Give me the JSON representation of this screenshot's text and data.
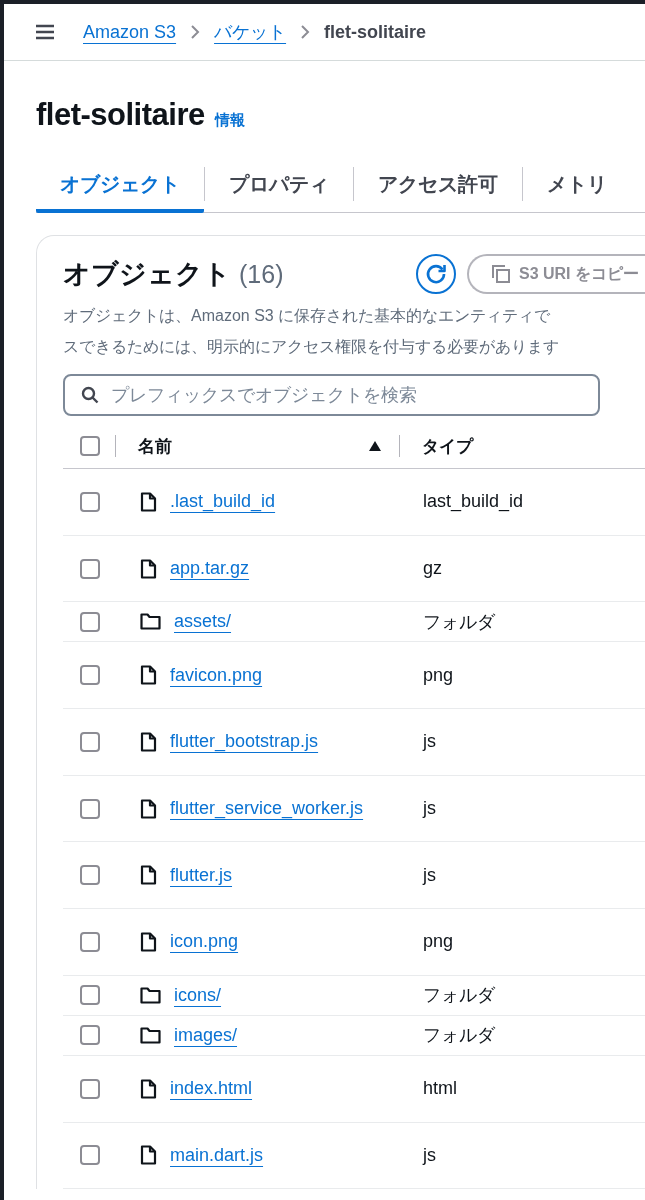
{
  "breadcrumb": [
    {
      "label": "Amazon S3",
      "current": false
    },
    {
      "label": "バケット",
      "current": false
    },
    {
      "label": "flet-solitaire",
      "current": true
    }
  ],
  "page": {
    "title": "flet-solitaire",
    "info": "情報"
  },
  "tabs": [
    {
      "label": "オブジェクト",
      "selected": true
    },
    {
      "label": "プロパティ",
      "selected": false
    },
    {
      "label": "アクセス許可",
      "selected": false
    },
    {
      "label": "メトリ",
      "selected": false
    }
  ],
  "objects_panel": {
    "title": "オブジェクト",
    "count": "(16)",
    "copy_button": "S3 URI をコピー",
    "description": [
      "オブジェクトは、Amazon S3 に保存された基本的なエンティティで",
      "スできるためには、明示的にアクセス権限を付与する必要があります"
    ],
    "search": {
      "placeholder": "プレフィックスでオブジェクトを検索"
    },
    "select_all": {
      "checked": false
    },
    "columns": [
      {
        "label": "名前",
        "sorted": true
      },
      {
        "label": "タイプ",
        "sorted": false
      }
    ],
    "rows": [
      {
        "name": ".last_build_id",
        "type": "last_build_id",
        "kind": "file",
        "checked": false
      },
      {
        "name": "app.tar.gz",
        "type": "gz",
        "kind": "file",
        "checked": false
      },
      {
        "name": "assets/",
        "type": "フォルダ",
        "kind": "folder",
        "checked": false
      },
      {
        "name": "favicon.png",
        "type": "png",
        "kind": "file",
        "checked": false
      },
      {
        "name": "flutter_bootstrap.js",
        "type": "js",
        "kind": "file",
        "checked": false
      },
      {
        "name": "flutter_service_worker.js",
        "type": "js",
        "kind": "file",
        "checked": false
      },
      {
        "name": "flutter.js",
        "type": "js",
        "kind": "file",
        "checked": false
      },
      {
        "name": "icon.png",
        "type": "png",
        "kind": "file",
        "checked": false
      },
      {
        "name": "icons/",
        "type": "フォルダ",
        "kind": "folder",
        "checked": false
      },
      {
        "name": "images/",
        "type": "フォルダ",
        "kind": "folder",
        "checked": false
      },
      {
        "name": "index.html",
        "type": "html",
        "kind": "file",
        "checked": false
      },
      {
        "name": "main.dart.js",
        "type": "js",
        "kind": "file",
        "checked": false
      }
    ]
  }
}
